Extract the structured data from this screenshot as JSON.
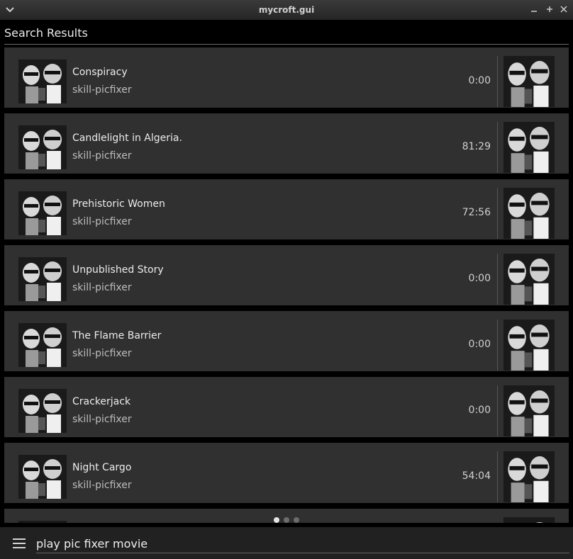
{
  "window": {
    "title": "mycroft.gui"
  },
  "header": {
    "title": "Search Results"
  },
  "results": [
    {
      "title": "Conspiracy",
      "skill": "skill-picfixer",
      "duration": "0:00"
    },
    {
      "title": "Candlelight in Algeria.",
      "skill": "skill-picfixer",
      "duration": "81:29"
    },
    {
      "title": "Prehistoric Women",
      "skill": "skill-picfixer",
      "duration": "72:56"
    },
    {
      "title": "Unpublished Story",
      "skill": "skill-picfixer",
      "duration": "0:00"
    },
    {
      "title": "The Flame Barrier",
      "skill": "skill-picfixer",
      "duration": "0:00"
    },
    {
      "title": "Crackerjack",
      "skill": "skill-picfixer",
      "duration": "0:00"
    },
    {
      "title": "Night Cargo",
      "skill": "skill-picfixer",
      "duration": "54:04"
    }
  ],
  "pager": {
    "pages": 3,
    "current": 1
  },
  "query": {
    "value": "play pic fixer movie"
  },
  "icons": {
    "menu": "hamburger-icon",
    "window_menu": "chevron-down-icon"
  },
  "colors": {
    "card_bg": "#303030",
    "background": "#000000",
    "bottombar": "#212121"
  }
}
